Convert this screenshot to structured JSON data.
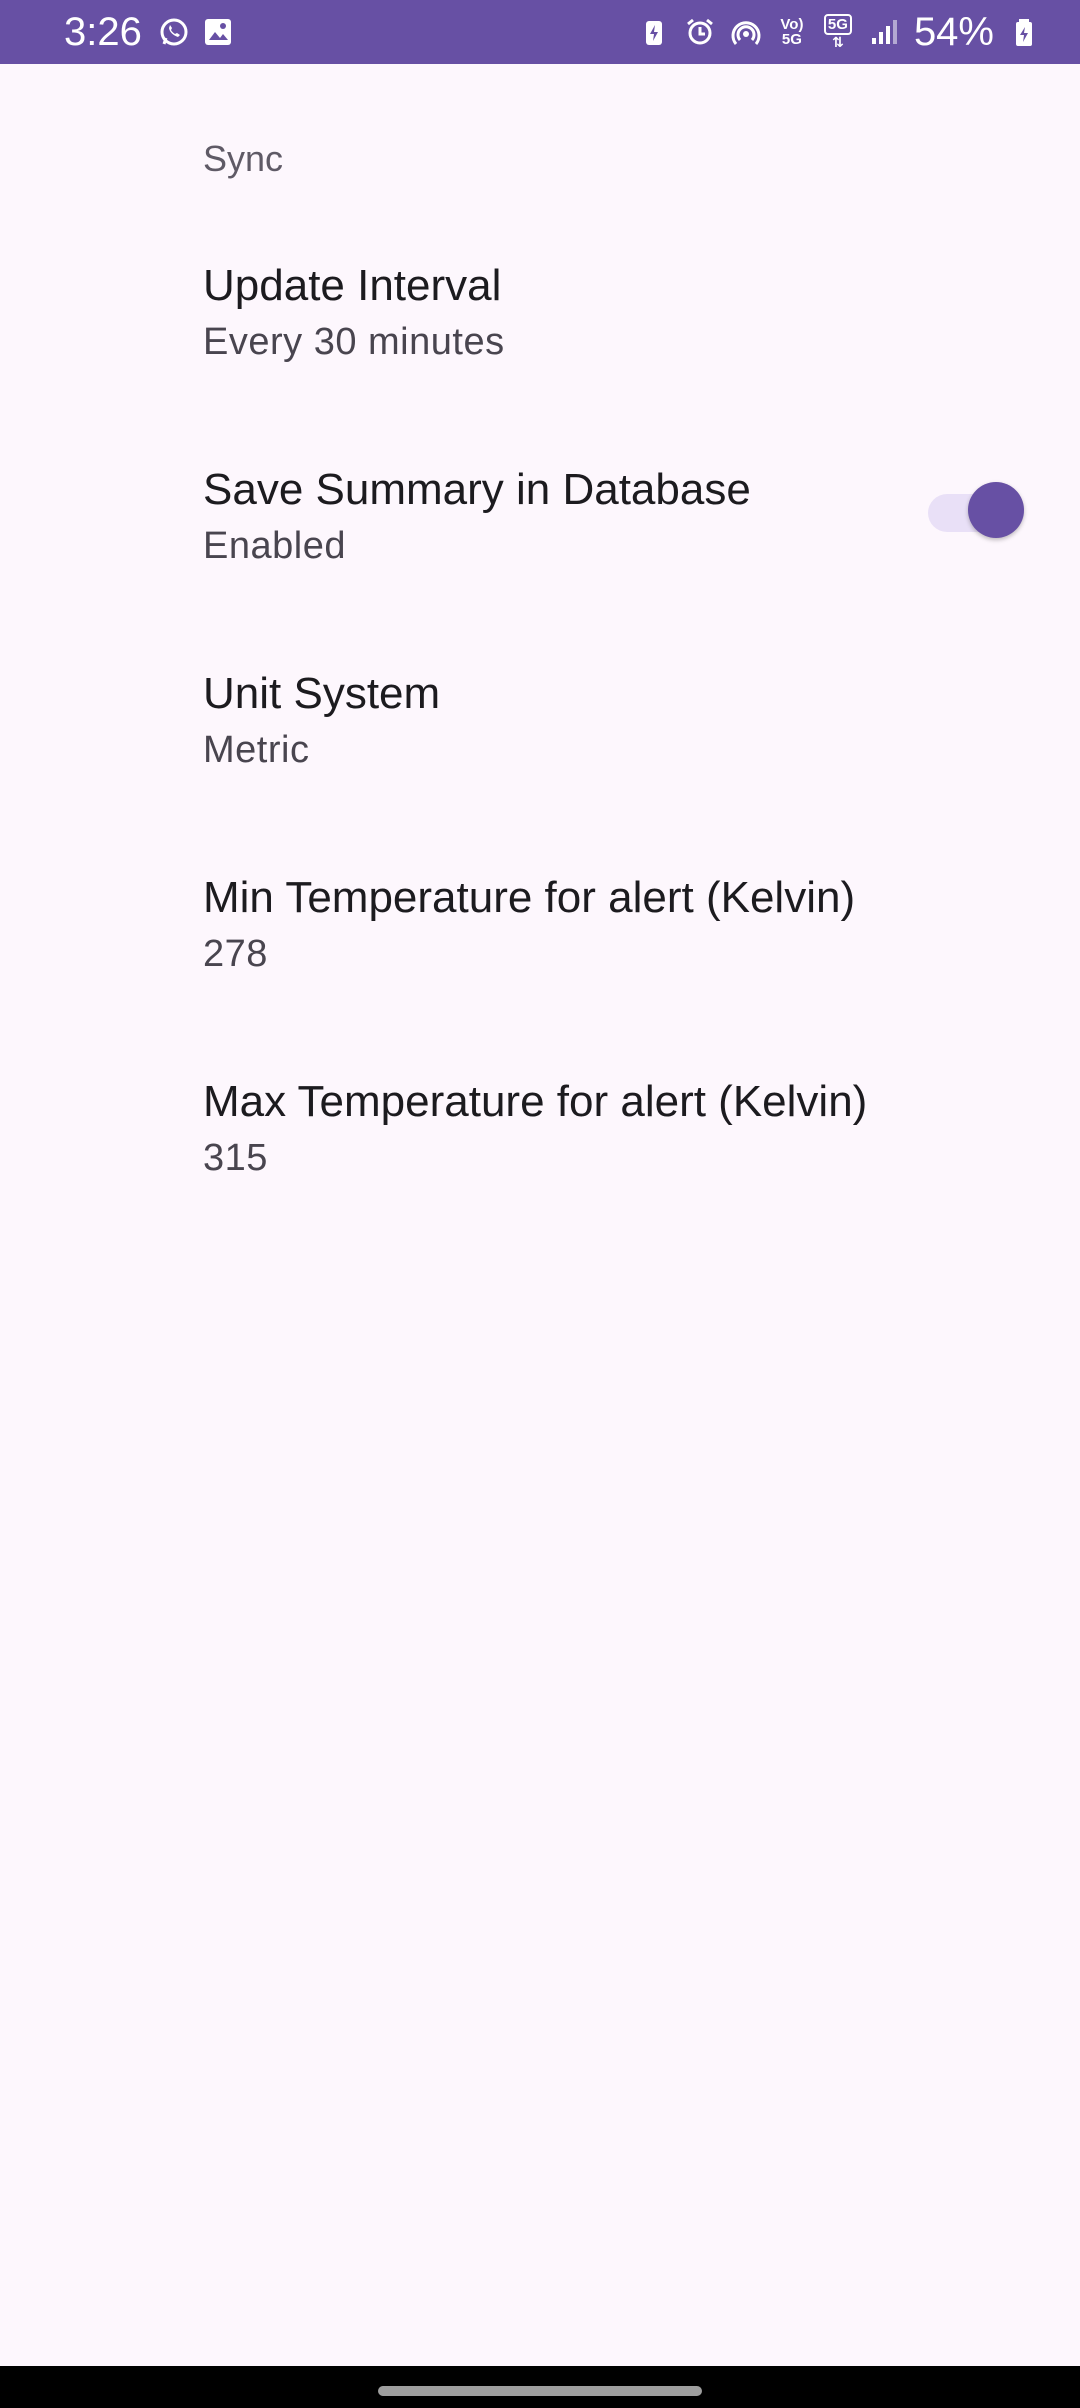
{
  "status_bar": {
    "time": "3:26",
    "battery_percent": "54%",
    "network_label_top": "Vo)",
    "network_label_bottom": "5G",
    "network_type": "5G",
    "icons": [
      "whatsapp-icon",
      "gallery-icon",
      "battery-saver-icon",
      "alarm-icon",
      "hotspot-icon",
      "volte-icon",
      "5g-icon",
      "signal-icon",
      "battery-icon"
    ],
    "color": "#6750a4"
  },
  "settings": {
    "section_header": "Sync",
    "items": [
      {
        "title": "Update Interval",
        "summary": "Every 30 minutes"
      },
      {
        "title": "Save Summary in Database",
        "summary": "Enabled",
        "toggle_on": true
      },
      {
        "title": "Unit System",
        "summary": "Metric"
      },
      {
        "title": "Min Temperature for alert (Kelvin)",
        "summary": "278"
      },
      {
        "title": "Max Temperature for alert (Kelvin)",
        "summary": "315"
      }
    ]
  },
  "colors": {
    "accent": "#6750a4",
    "background": "#fdf7fd",
    "toggle_track": "#e9e0f7"
  }
}
